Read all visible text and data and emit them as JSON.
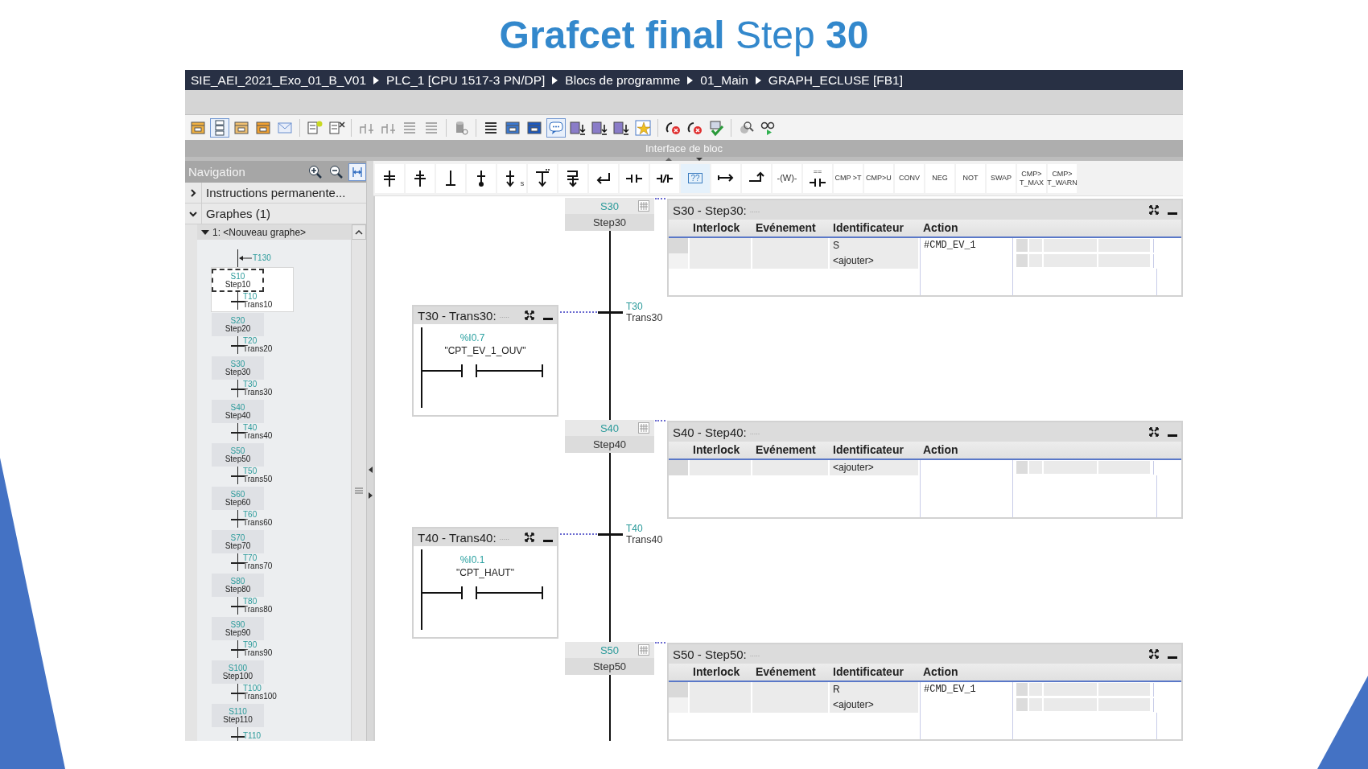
{
  "slide_title": "**Grafcet final** Step **30**",
  "breadcrumb": [
    "SIE_AEI_2021_Exo_01_B_V01",
    "PLC_1 [CPU 1517-3 PN/DP]",
    "Blocs de programme",
    "01_Main",
    "GRAPH_ECLUSE [FB1]"
  ],
  "interface_bar": {
    "title": "Interface de bloc"
  },
  "navigation": {
    "title": "Navigation",
    "sections": [
      {
        "label": "Instructions permanente...",
        "expanded": false
      },
      {
        "label": "Graphes (1)",
        "expanded": true
      }
    ],
    "graph": {
      "title": "1: <Nouveau graphe>",
      "expanded": true,
      "entry": "T130",
      "elements": [
        {
          "kind": "step",
          "number": "S10",
          "name": "Step10",
          "selected": true
        },
        {
          "kind": "transition",
          "number": "T10",
          "name": "Trans10"
        },
        {
          "kind": "step",
          "number": "S20",
          "name": "Step20",
          "selected": false
        },
        {
          "kind": "transition",
          "number": "T20",
          "name": "Trans20"
        },
        {
          "kind": "step",
          "number": "S30",
          "name": "Step30",
          "selected": false
        },
        {
          "kind": "transition",
          "number": "T30",
          "name": "Trans30"
        },
        {
          "kind": "step",
          "number": "S40",
          "name": "Step40",
          "selected": false
        },
        {
          "kind": "transition",
          "number": "T40",
          "name": "Trans40"
        },
        {
          "kind": "step",
          "number": "S50",
          "name": "Step50",
          "selected": false
        },
        {
          "kind": "transition",
          "number": "T50",
          "name": "Trans50"
        },
        {
          "kind": "step",
          "number": "S60",
          "name": "Step60",
          "selected": false
        },
        {
          "kind": "transition",
          "number": "T60",
          "name": "Trans60"
        },
        {
          "kind": "step",
          "number": "S70",
          "name": "Step70",
          "selected": false
        },
        {
          "kind": "transition",
          "number": "T70",
          "name": "Trans70"
        },
        {
          "kind": "step",
          "number": "S80",
          "name": "Step80",
          "selected": false
        },
        {
          "kind": "transition",
          "number": "T80",
          "name": "Trans80"
        },
        {
          "kind": "step",
          "number": "S90",
          "name": "Step90",
          "selected": false
        },
        {
          "kind": "transition",
          "number": "T90",
          "name": "Trans90"
        },
        {
          "kind": "step",
          "number": "S100",
          "name": "Step100",
          "selected": false
        },
        {
          "kind": "transition",
          "number": "T100",
          "name": "Trans100"
        },
        {
          "kind": "step",
          "number": "S110",
          "name": "Step110",
          "selected": false
        },
        {
          "kind": "transition",
          "number": "T110"
        }
      ]
    }
  },
  "instruction_bar": {
    "symbol_buttons": [
      {
        "kind": "branch"
      },
      {
        "kind": "transition"
      },
      {
        "kind": "down-line"
      },
      {
        "kind": "line-dot"
      },
      {
        "kind": "arrow",
        "subscript": "s"
      },
      {
        "kind": "branch-down"
      },
      {
        "kind": "stacked"
      },
      {
        "kind": "return"
      },
      {
        "kind": "contact"
      },
      {
        "kind": "negated"
      },
      {
        "kind": "box",
        "label": "??"
      },
      {
        "kind": "right-arrow"
      },
      {
        "kind": "step-arrow"
      },
      {
        "kind": "coil",
        "label": "-(W)-"
      },
      {
        "kind": "compare",
        "label": "=="
      }
    ],
    "text_buttons": [
      "CMP >T",
      "CMP>U",
      "CONV",
      "NEG",
      "NOT",
      "SWAP",
      "CMP>\nT_MAX",
      "CMP>\nT_WARN"
    ]
  },
  "sequence": [
    {
      "kind": "step",
      "number": "S30",
      "name": "Step30",
      "table": {
        "title": "S30 - Step30:",
        "comment": ".....",
        "columns": [
          "Interlock",
          "Evénement",
          "Identificateur",
          "Action"
        ],
        "rows": [
          {
            "kind": "action",
            "qualifier": "S",
            "action": "#CMD_EV_1"
          },
          {
            "kind": "add",
            "label": "<ajouter>"
          }
        ]
      }
    },
    {
      "kind": "transition",
      "number": "T30",
      "name": "Trans30",
      "condition": {
        "title": "T30 - Trans30:",
        "comment": ".....",
        "address": "%I0.7",
        "operand": "\"CPT_EV_1_OUV\""
      }
    },
    {
      "kind": "step",
      "number": "S40",
      "name": "Step40",
      "table": {
        "title": "S40 - Step40:",
        "comment": ".....",
        "columns": [
          "Interlock",
          "Evénement",
          "Identificateur",
          "Action"
        ],
        "rows": [
          {
            "kind": "add",
            "label": "<ajouter>"
          }
        ]
      }
    },
    {
      "kind": "transition",
      "number": "T40",
      "name": "Trans40",
      "condition": {
        "title": "T40 - Trans40:",
        "comment": ".....",
        "address": "%I0.1",
        "operand": "\"CPT_HAUT\""
      }
    },
    {
      "kind": "step",
      "number": "S50",
      "name": "Step50",
      "table": {
        "title": "S50 - Step50:",
        "comment": ".....",
        "columns": [
          "Interlock",
          "Evénement",
          "Identificateur",
          "Action"
        ],
        "rows": [
          {
            "kind": "action",
            "qualifier": "R",
            "action": "#CMD_EV_1"
          },
          {
            "kind": "add",
            "label": "<ajouter>"
          }
        ]
      }
    }
  ]
}
